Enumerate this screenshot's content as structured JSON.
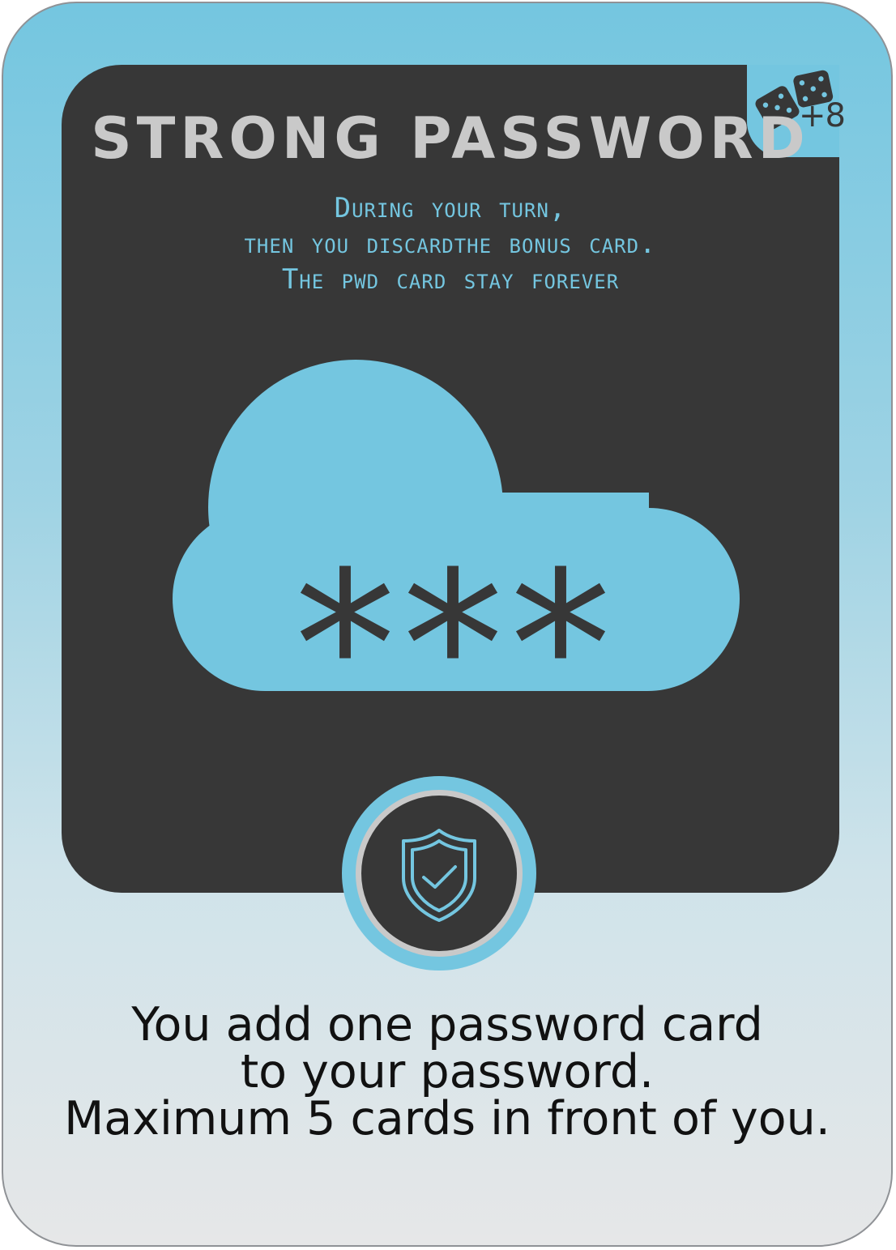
{
  "card": {
    "title": "Strong Password",
    "bonus_value": "+8",
    "bonus_icon": "dice-icon",
    "rules_lines": [
      "During your turn,",
      "then you discardthe bonus card.",
      "The pwd card stay forever"
    ],
    "illustration": {
      "icon": "password-cloud-icon",
      "symbol": "***"
    },
    "emblem_icon": "shield-check-icon",
    "effect_lines": [
      "You add one password card",
      "to your password.",
      "Maximum 5 cards in front of you."
    ],
    "colors": {
      "accent": "#74c6e0",
      "panel": "#373737",
      "title": "#c9c9c9",
      "text": "#111111"
    }
  }
}
